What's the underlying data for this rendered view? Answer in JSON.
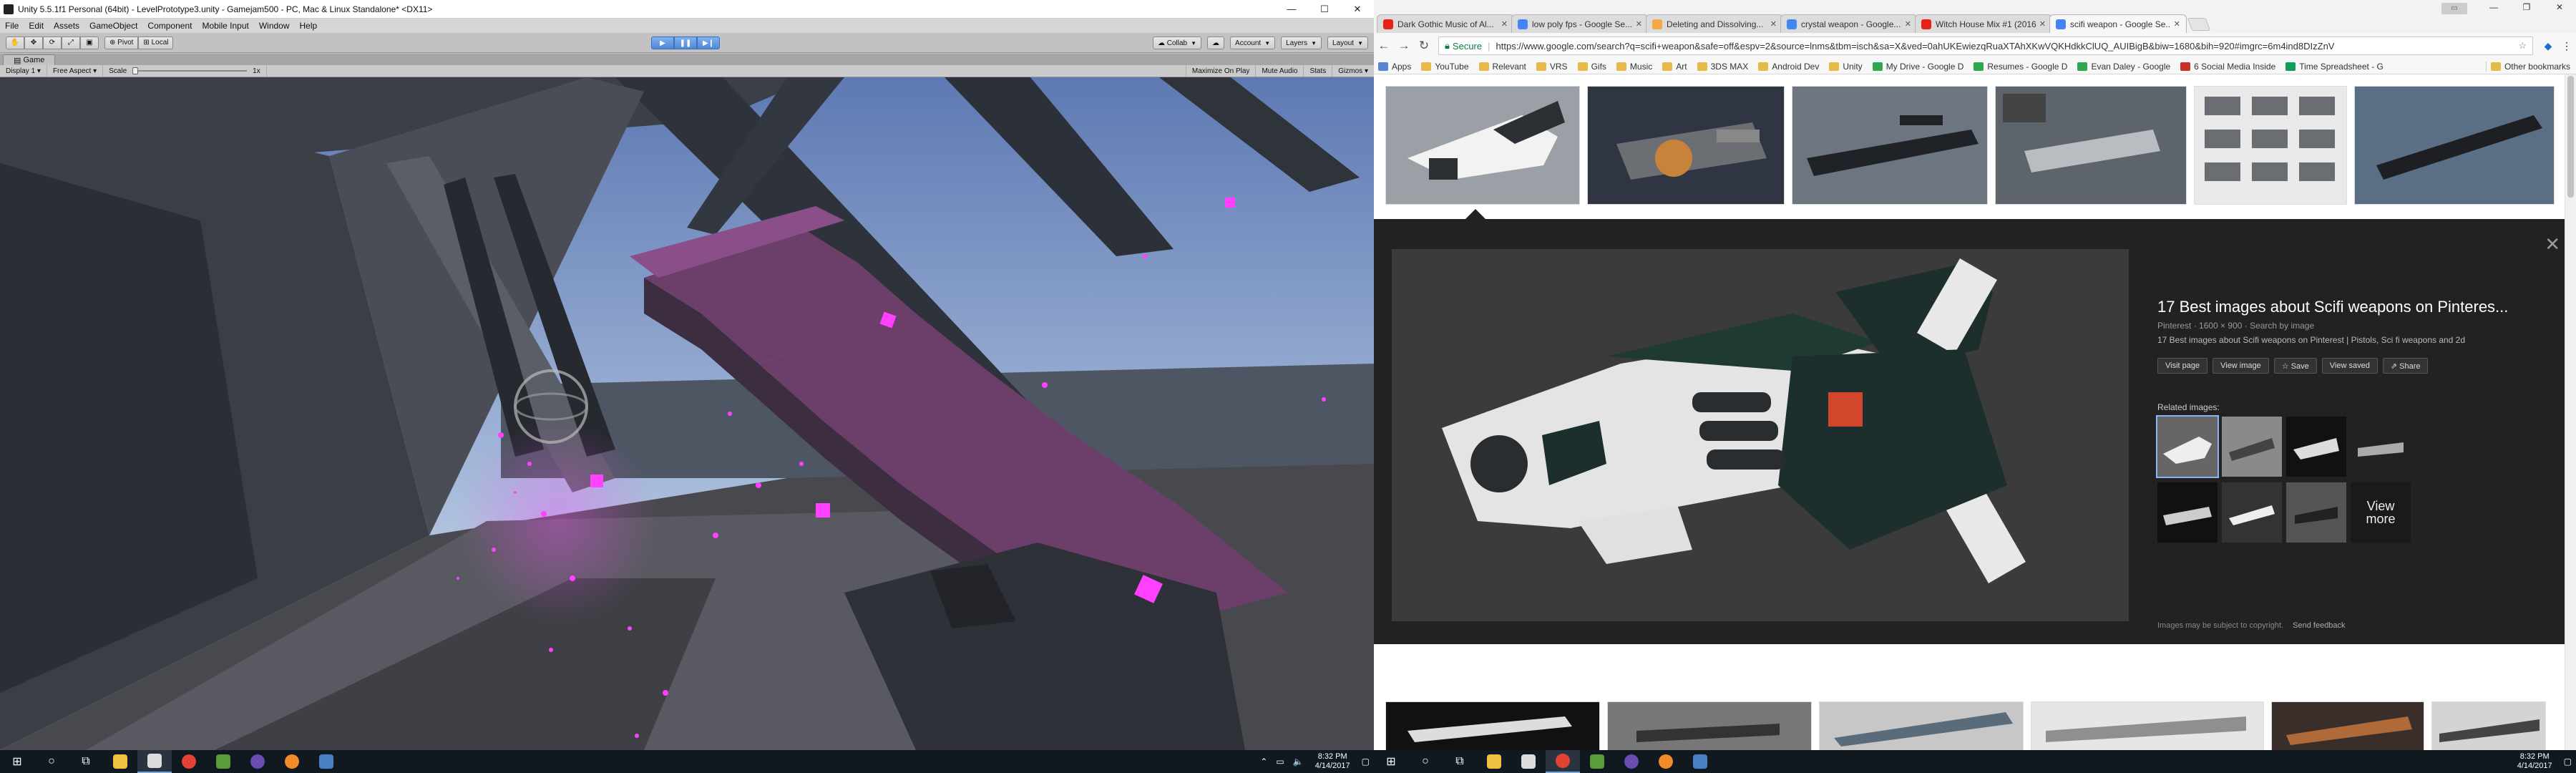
{
  "unity": {
    "window_title": "Unity 5.5.1f1 Personal (64bit) - LevelPrototype3.unity - Gamejam500 - PC, Mac & Linux Standalone* <DX11>",
    "window_buttons": [
      "—",
      "☐",
      "✕"
    ],
    "menu": [
      "File",
      "Edit",
      "Assets",
      "GameObject",
      "Component",
      "Mobile Input",
      "Window",
      "Help"
    ],
    "toolbar": {
      "pivot": "Pivot",
      "local": "Local",
      "collab": "Collab",
      "account": "Account",
      "layers": "Layers",
      "layout": "Layout"
    },
    "game_tab": "Game",
    "game_bar": {
      "display": "Display 1",
      "aspect": "Free Aspect",
      "scale_label": "Scale",
      "scale_value": "1x",
      "maximize_on_play": "Maximize On Play",
      "mute_audio": "Mute Audio",
      "stats": "Stats",
      "gizmos": "Gizmos"
    }
  },
  "taskbar_left": {
    "time": "8:32 PM",
    "date": "4/14/2017"
  },
  "taskbar_right": {
    "time": "8:32 PM",
    "date": "4/14/2017"
  },
  "chrome": {
    "tabs": [
      {
        "label": "Dark Gothic Music of Al...",
        "fav_color": "#e62117",
        "active": false
      },
      {
        "label": "low poly fps - Google Se...",
        "fav_color": "#4285f4",
        "active": false
      },
      {
        "label": "Deleting and Dissolving...",
        "fav_color": "#f4a742",
        "active": false
      },
      {
        "label": "crystal weapon - Google...",
        "fav_color": "#4285f4",
        "active": false
      },
      {
        "label": "Witch House Mix #1 (2016...",
        "fav_color": "#e62117",
        "active": false
      },
      {
        "label": "scifi weapon - Google Se...",
        "fav_color": "#4285f4",
        "active": true
      }
    ],
    "address": {
      "secure_label": "Secure",
      "url": "https://www.google.com/search?q=scifi+weapon&safe=off&espv=2&source=lnms&tbm=isch&sa=X&ved=0ahUKEwiezqRuaXTAhXKwVQKHdkkClUQ_AUIBigB&biw=1680&bih=920#imgrc=6m4ind8DIzZnV"
    },
    "bookmarks": [
      {
        "label": "Apps",
        "type": "apps"
      },
      {
        "label": "YouTube",
        "type": "folder"
      },
      {
        "label": "Relevant",
        "type": "folder"
      },
      {
        "label": "VRS",
        "type": "folder"
      },
      {
        "label": "Gifs",
        "type": "folder"
      },
      {
        "label": "Music",
        "type": "folder"
      },
      {
        "label": "Art",
        "type": "folder"
      },
      {
        "label": "3DS MAX",
        "type": "folder"
      },
      {
        "label": "Android Dev",
        "type": "folder"
      },
      {
        "label": "Unity",
        "type": "folder"
      },
      {
        "label": "My Drive - Google D",
        "type": "drive"
      },
      {
        "label": "Resumes - Google D",
        "type": "drive"
      },
      {
        "label": "Evan Daley - Google",
        "type": "drive"
      },
      {
        "label": "6 Social Media Inside",
        "type": "red"
      },
      {
        "label": "Time Spreadsheet - G",
        "type": "sheet"
      }
    ],
    "other_bookmarks": "Other bookmarks",
    "panel": {
      "title": "17 Best images about Scifi weapons on Pinteres...",
      "meta": "Pinterest · 1600 × 900 · Search by image",
      "desc": "17 Best images about Scifi weapons on Pinterest | Pistols, Sci fi weapons and 2d",
      "buttons": [
        "Visit page",
        "View image",
        "☆ Save",
        "View saved",
        "⇗ Share"
      ],
      "related_header": "Related images:",
      "view_more": "View more",
      "footer_note": "Images may be subject to copyright.",
      "footer_link": "Send feedback"
    }
  }
}
